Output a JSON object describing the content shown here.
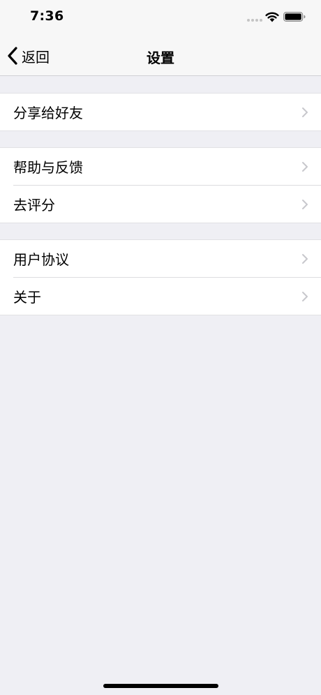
{
  "status_bar": {
    "time": "7:36",
    "signal_icon": "signal-dots-icon",
    "wifi_icon": "wifi-icon",
    "battery_icon": "battery-icon"
  },
  "nav": {
    "back_label": "返回",
    "back_icon": "chevron-left-icon",
    "title": "设置"
  },
  "groups": [
    {
      "items": [
        {
          "label": "分享给好友"
        }
      ]
    },
    {
      "items": [
        {
          "label": "帮助与反馈"
        },
        {
          "label": "去评分"
        }
      ]
    },
    {
      "items": [
        {
          "label": "用户协议"
        },
        {
          "label": "关于"
        }
      ]
    }
  ],
  "row_icon": "chevron-right-icon",
  "colors": {
    "background": "#efeff4",
    "cell": "#ffffff",
    "chevron": "#c7c7cc",
    "text": "#000000"
  }
}
